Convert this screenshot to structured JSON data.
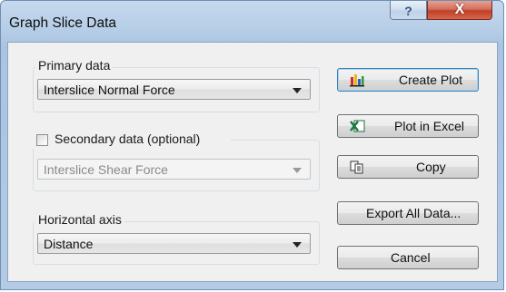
{
  "window": {
    "title": "Graph Slice Data",
    "help_glyph": "?",
    "close_glyph": "X"
  },
  "primary": {
    "label": "Primary data",
    "selected": "Interslice Normal Force"
  },
  "secondary": {
    "label": "Secondary data (optional)",
    "checked": false,
    "selected": "Interslice Shear Force"
  },
  "horizontal": {
    "label": "Horizontal axis",
    "selected": "Distance"
  },
  "buttons": {
    "create_plot": "Create Plot",
    "plot_excel": "Plot in Excel",
    "copy": "Copy",
    "export_all": "Export All Data...",
    "cancel": "Cancel"
  },
  "icons": {
    "create_plot": "bar-chart-icon",
    "plot_excel": "excel-icon",
    "copy": "copy-icon"
  },
  "colors": {
    "title_bar": "#b8cfe8",
    "close_button": "#c0402a",
    "dialog_bg": "#f0f0f0",
    "default_button_border": "#3c7fb1"
  }
}
